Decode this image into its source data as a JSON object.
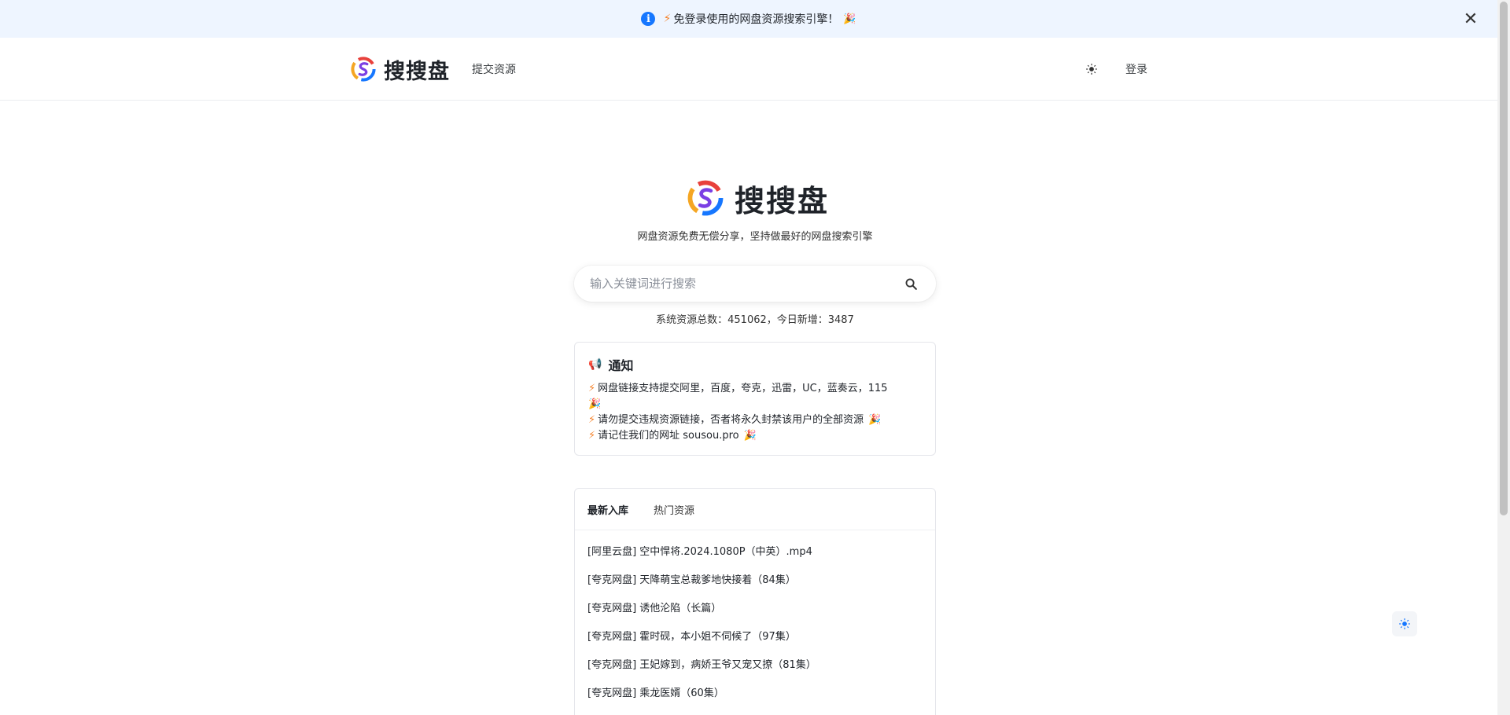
{
  "announcement": {
    "text": "免登录使用的网盘资源搜索引擎！",
    "info_icon": "i",
    "bolt_icon": "⚡",
    "party_icon": "🎉",
    "close_icon": "✕"
  },
  "header": {
    "brand_name": "搜搜盘",
    "nav_submit": "提交资源",
    "login": "登录"
  },
  "hero": {
    "brand_name": "搜搜盘",
    "tagline": "网盘资源免费无偿分享，坚持做最好的网盘搜索引擎"
  },
  "search": {
    "placeholder": "输入关键词进行搜索",
    "value": ""
  },
  "stats": {
    "text": "系统资源总数：451062，今日新增：3487"
  },
  "notice": {
    "title": "通知",
    "lines": [
      "网盘链接支持提交阿里，百度，夸克，迅雷，UC，蓝奏云，115",
      "请勿提交违规资源链接，否者将永久封禁该用户的全部资源",
      "请记住我们的网址 sousou.pro"
    ]
  },
  "resources": {
    "tabs": [
      "最新入库",
      "热门资源"
    ],
    "items": [
      "[阿里云盘] 空中悍将.2024.1080P（中英）.mp4",
      "[夸克网盘] 天降萌宝总裁爹地快接着（84集）",
      "[夸克网盘] 诱他沦陷（长篇）",
      "[夸克网盘] 霍时砚，本小姐不伺候了（97集）",
      "[夸克网盘] 王妃嫁到，病娇王爷又宠又撩（81集）",
      "[夸克网盘] 乘龙医婿（60集）"
    ]
  },
  "colors": {
    "accent": "#1677ff",
    "bolt": "#f5822a",
    "announce_bg": "#eef5ff"
  }
}
